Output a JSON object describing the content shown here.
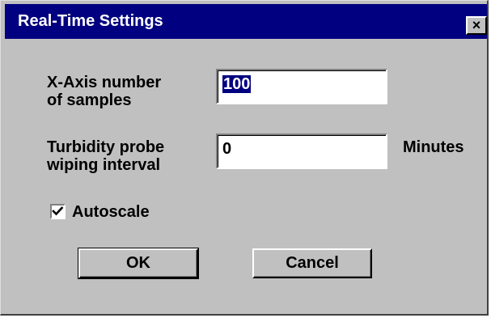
{
  "window": {
    "title": "Real-Time Settings",
    "close_glyph": "×",
    "close_icon": "close-icon"
  },
  "form": {
    "samples_label_line1": "X-Axis number",
    "samples_label_line2": "of samples",
    "samples_value": "100",
    "wiping_label_line1": "Turbidity probe",
    "wiping_label_line2": "wiping interval",
    "wiping_value": "0",
    "wiping_unit": "Minutes",
    "autoscale_label": "Autoscale",
    "autoscale_checked": true,
    "check_icon": "checkmark-icon"
  },
  "buttons": {
    "ok_label": "OK",
    "cancel_label": "Cancel"
  }
}
